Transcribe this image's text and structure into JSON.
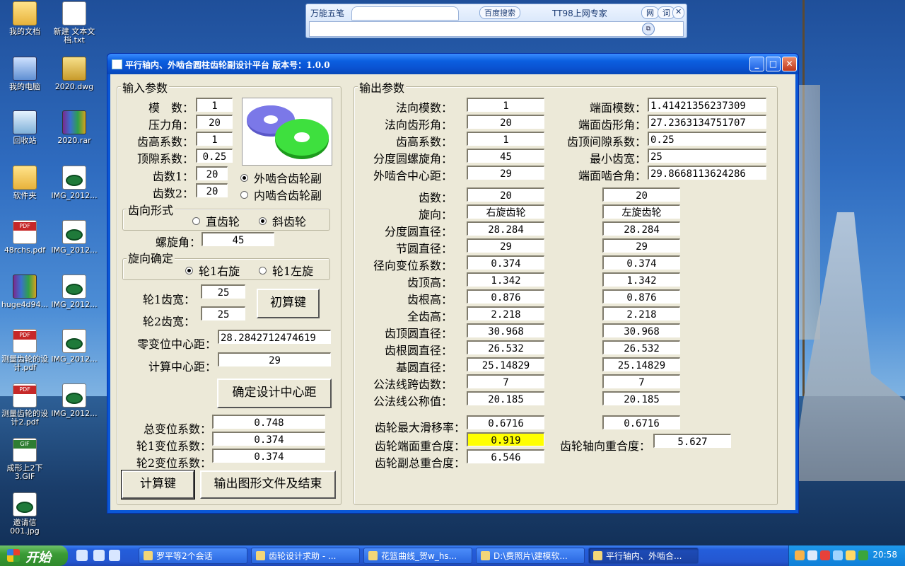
{
  "desktop": {
    "icons": [
      {
        "label": "我的文档",
        "kind": "folder"
      },
      {
        "label": "新建 文本文档.txt",
        "kind": "doc"
      },
      {
        "label": "我的电脑",
        "kind": "pc"
      },
      {
        "label": "2020.dwg",
        "kind": "dwg"
      },
      {
        "label": "回收站",
        "kind": "bin"
      },
      {
        "label": "2020.rar",
        "kind": "rar"
      },
      {
        "label": "软件夹",
        "kind": "folder"
      },
      {
        "label": "IMG_2012...",
        "kind": "jpg"
      },
      {
        "label": "48rchs.pdf",
        "kind": "pdf"
      },
      {
        "label": "IMG_2012...",
        "kind": "jpg"
      },
      {
        "label": "huge4d94...",
        "kind": "rar"
      },
      {
        "label": "IMG_2012...",
        "kind": "jpg"
      },
      {
        "label": "测量齿轮的设计.pdf",
        "kind": "pdf"
      },
      {
        "label": "IMG_2012...",
        "kind": "jpg"
      },
      {
        "label": "测量齿轮的设计2.pdf",
        "kind": "pdf"
      },
      {
        "label": "IMG_2012...",
        "kind": "jpg"
      },
      {
        "label": "成形上2下3.GIF",
        "kind": "gif"
      },
      {
        "label": "邀请信001.jpg",
        "kind": "jpg"
      }
    ]
  },
  "toolbar": {
    "ime": "万能五笔",
    "search": "百度搜索",
    "expert": "TT98上网专家",
    "net": "网",
    "word": "词",
    "close": "✕",
    "go": "⧉"
  },
  "window": {
    "title": "平行轴内、外啮合圆柱齿轮副设计平台 版本号：1.0.0",
    "min": "_",
    "max": "□",
    "close": "✕"
  },
  "input": {
    "group_title": "输入参数",
    "fields": [
      {
        "label": "模　数：",
        "value": "1"
      },
      {
        "label": "压力角：",
        "value": "20"
      },
      {
        "label": "齿高系数：",
        "value": "1"
      },
      {
        "label": "顶隙系数：",
        "value": "0.25"
      },
      {
        "label": "齿数1：",
        "value": "20"
      },
      {
        "label": "齿数2：",
        "value": "20"
      }
    ],
    "mesh_external": "外啮合齿轮副",
    "mesh_internal": "内啮合齿轮副",
    "tooth_form_title": "齿向形式",
    "spur": "直齿轮",
    "helical": "斜齿轮",
    "helix_label": "螺旋角：",
    "helix_value": "45",
    "hand_title": "旋向确定",
    "hand1_right": "轮1右旋",
    "hand1_left": "轮1左旋",
    "width1_label": "轮1齿宽：",
    "width1_value": "25",
    "width2_label": "轮2齿宽：",
    "width2_value": "25",
    "init_button": "初算键",
    "zero_center_label": "零变位中心距：",
    "zero_center_value": "28.2842712474619",
    "calc_center_label": "计算中心距：",
    "calc_center_value": "29",
    "confirm_center_button": "确定设计中心距",
    "total_shift_label": "总变位系数：",
    "total_shift_value": "0.748",
    "shift1_label": "轮1变位系数：",
    "shift1_value": "0.374",
    "shift2_label": "轮2变位系数：",
    "shift2_value": "0.374",
    "calc_button": "计算键",
    "export_button": "输出图形文件及结束"
  },
  "output": {
    "group_title": "输出参数",
    "left_top": [
      {
        "label": "法向模数：",
        "value": "1"
      },
      {
        "label": "法向齿形角：",
        "value": "20"
      },
      {
        "label": "齿高系数：",
        "value": "1"
      },
      {
        "label": "分度圆螺旋角：",
        "value": "45"
      },
      {
        "label": "外啮合中心距：",
        "value": "29"
      }
    ],
    "right_top": [
      {
        "label": "端面模数：",
        "value": "1.41421356237309"
      },
      {
        "label": "端面齿形角：",
        "value": "27.2363134751707"
      },
      {
        "label": "齿顶间隙系数：",
        "value": "0.25"
      },
      {
        "label": "最小齿宽：",
        "value": "25"
      },
      {
        "label": "端面啮合角：",
        "value": "29.8668113624286"
      }
    ],
    "rows": [
      {
        "label": "齿数：",
        "g1": "20",
        "g2": "20"
      },
      {
        "label": "旋向：",
        "g1": "右旋齿轮",
        "g2": "左旋齿轮"
      },
      {
        "label": "分度圆直径：",
        "g1": "28.284",
        "g2": "28.284"
      },
      {
        "label": "节圆直径：",
        "g1": "29",
        "g2": "29"
      },
      {
        "label": "径向变位系数：",
        "g1": "0.374",
        "g2": "0.374"
      },
      {
        "label": "齿顶高：",
        "g1": "1.342",
        "g2": "1.342"
      },
      {
        "label": "齿根高：",
        "g1": "0.876",
        "g2": "0.876"
      },
      {
        "label": "全齿高：",
        "g1": "2.218",
        "g2": "2.218"
      },
      {
        "label": "齿顶圆直径：",
        "g1": "30.968",
        "g2": "30.968"
      },
      {
        "label": "齿根圆直径：",
        "g1": "26.532",
        "g2": "26.532"
      },
      {
        "label": "基圆直径：",
        "g1": "25.14829",
        "g2": "25.14829"
      },
      {
        "label": "公法线跨齿数：",
        "g1": "7",
        "g2": "7"
      },
      {
        "label": "公法线公称值：",
        "g1": "20.185",
        "g2": "20.185"
      }
    ],
    "slip_label": "齿轮最大滑移率：",
    "slip_g1": "0.6716",
    "slip_g2": "0.6716",
    "transverse_label": "齿轮端面重合度：",
    "transverse_value": "0.919",
    "axial_label": "齿轮轴向重合度：",
    "axial_value": "5.627",
    "total_label": "齿轮副总重合度：",
    "total_value": "6.546"
  },
  "taskbar": {
    "start": "开始",
    "tasks": [
      {
        "label": "罗平等2个会话",
        "active": false
      },
      {
        "label": "齿轮设计求助 - ...",
        "active": false
      },
      {
        "label": "花篮曲线_贺w_hs...",
        "active": false
      },
      {
        "label": "D:\\费照片\\建模软...",
        "active": false
      },
      {
        "label": "平行轴内、外啮合...",
        "active": true
      }
    ],
    "clock": "20:58"
  },
  "colors": {
    "highlight": "#ffff00",
    "window_face": "#ece9d8",
    "title_blue": "#0a52d1"
  }
}
